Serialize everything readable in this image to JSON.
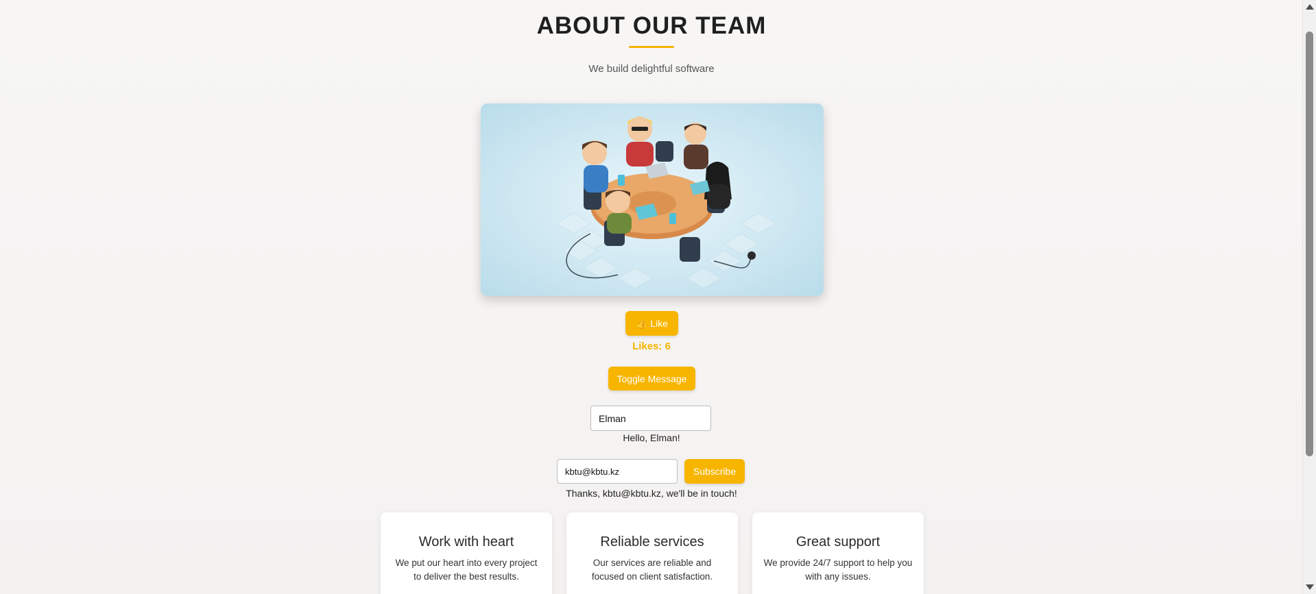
{
  "header": {
    "title": "ABOUT OUR TEAM",
    "subtitle": "We build delightful software"
  },
  "hero": {
    "image_alt": "Team illustration"
  },
  "like": {
    "button_label": "👍 Like",
    "count_text": "Likes: 6"
  },
  "toggle": {
    "button_label": "Toggle Message"
  },
  "name": {
    "value": "Elman",
    "greeting": "Hello, Elman!"
  },
  "subscribe": {
    "email_value": "kbtu@kbtu.kz",
    "button_label": "Subscribe",
    "thanks": "Thanks, kbtu@kbtu.kz, we'll be in touch!"
  },
  "features": [
    {
      "title": "Work with heart",
      "text": "We put our heart into every project to deliver the best results."
    },
    {
      "title": "Reliable services",
      "text": "Our services are reliable and focused on client satisfaction."
    },
    {
      "title": "Great support",
      "text": "We provide 24/7 support to help you with any issues."
    }
  ],
  "colors": {
    "accent": "#f7b500",
    "background": "#f6f5f4"
  }
}
